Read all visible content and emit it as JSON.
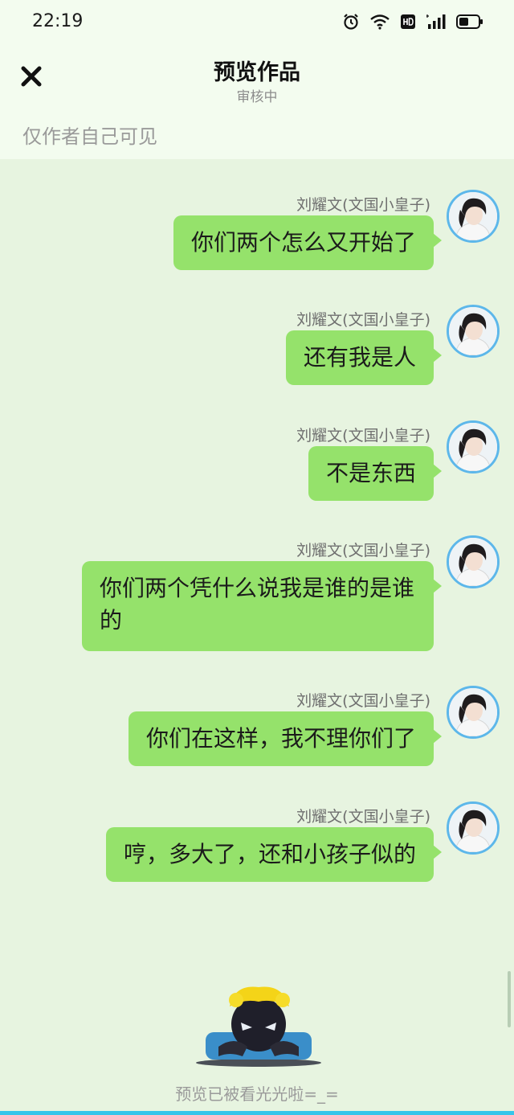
{
  "status_bar": {
    "time": "22:19"
  },
  "header": {
    "title": "预览作品",
    "subtitle": "审核中",
    "visibility": "仅作者自己可见"
  },
  "messages": [
    {
      "sender": "刘耀文(文国小皇子)",
      "text": "你们两个怎么又开始了"
    },
    {
      "sender": "刘耀文(文国小皇子)",
      "text": "还有我是人"
    },
    {
      "sender": "刘耀文(文国小皇子)",
      "text": "不是东西"
    },
    {
      "sender": "刘耀文(文国小皇子)",
      "text": "你们两个凭什么说我是谁的是谁的"
    },
    {
      "sender": "刘耀文(文国小皇子)",
      "text": "你们在这样，我不理你们了"
    },
    {
      "sender": "刘耀文(文国小皇子)",
      "text": "哼，多大了，还和小孩子似的"
    }
  ],
  "footer": {
    "text": "预览已被看光光啦=_="
  },
  "colors": {
    "bubble": "#95e26b",
    "background": "#e7f4e0",
    "avatar_ring": "#5db7ea"
  }
}
